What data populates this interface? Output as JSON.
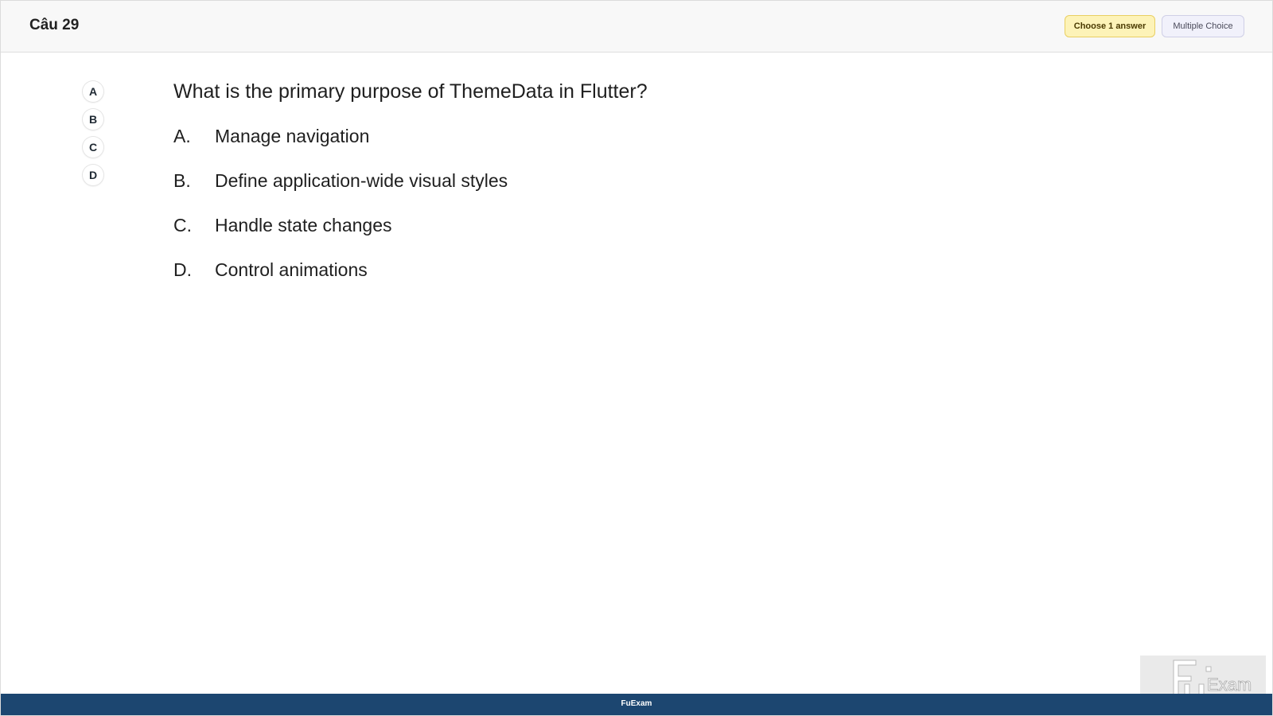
{
  "header": {
    "question_number": "Câu 29",
    "choose_badge": "Choose 1 answer",
    "type_badge": "Multiple Choice"
  },
  "answer_markers": [
    "A",
    "B",
    "C",
    "D"
  ],
  "question": {
    "text": "What is the primary purpose of ThemeData in Flutter?",
    "options": [
      {
        "letter": "A.",
        "text": "Manage navigation"
      },
      {
        "letter": "B.",
        "text": "Define application-wide visual styles"
      },
      {
        "letter": "C.",
        "text": "Handle state changes"
      },
      {
        "letter": "D.",
        "text": "Control animations"
      }
    ]
  },
  "footer": {
    "label": "FuExam"
  },
  "watermark": {
    "logo_text": "FU Exam",
    "icon": "fu-exam-logo-icon"
  },
  "colors": {
    "footer_bg": "#1c4670",
    "choose_badge_bg": "#fdf3b8",
    "type_badge_bg": "#f1f1fb"
  }
}
